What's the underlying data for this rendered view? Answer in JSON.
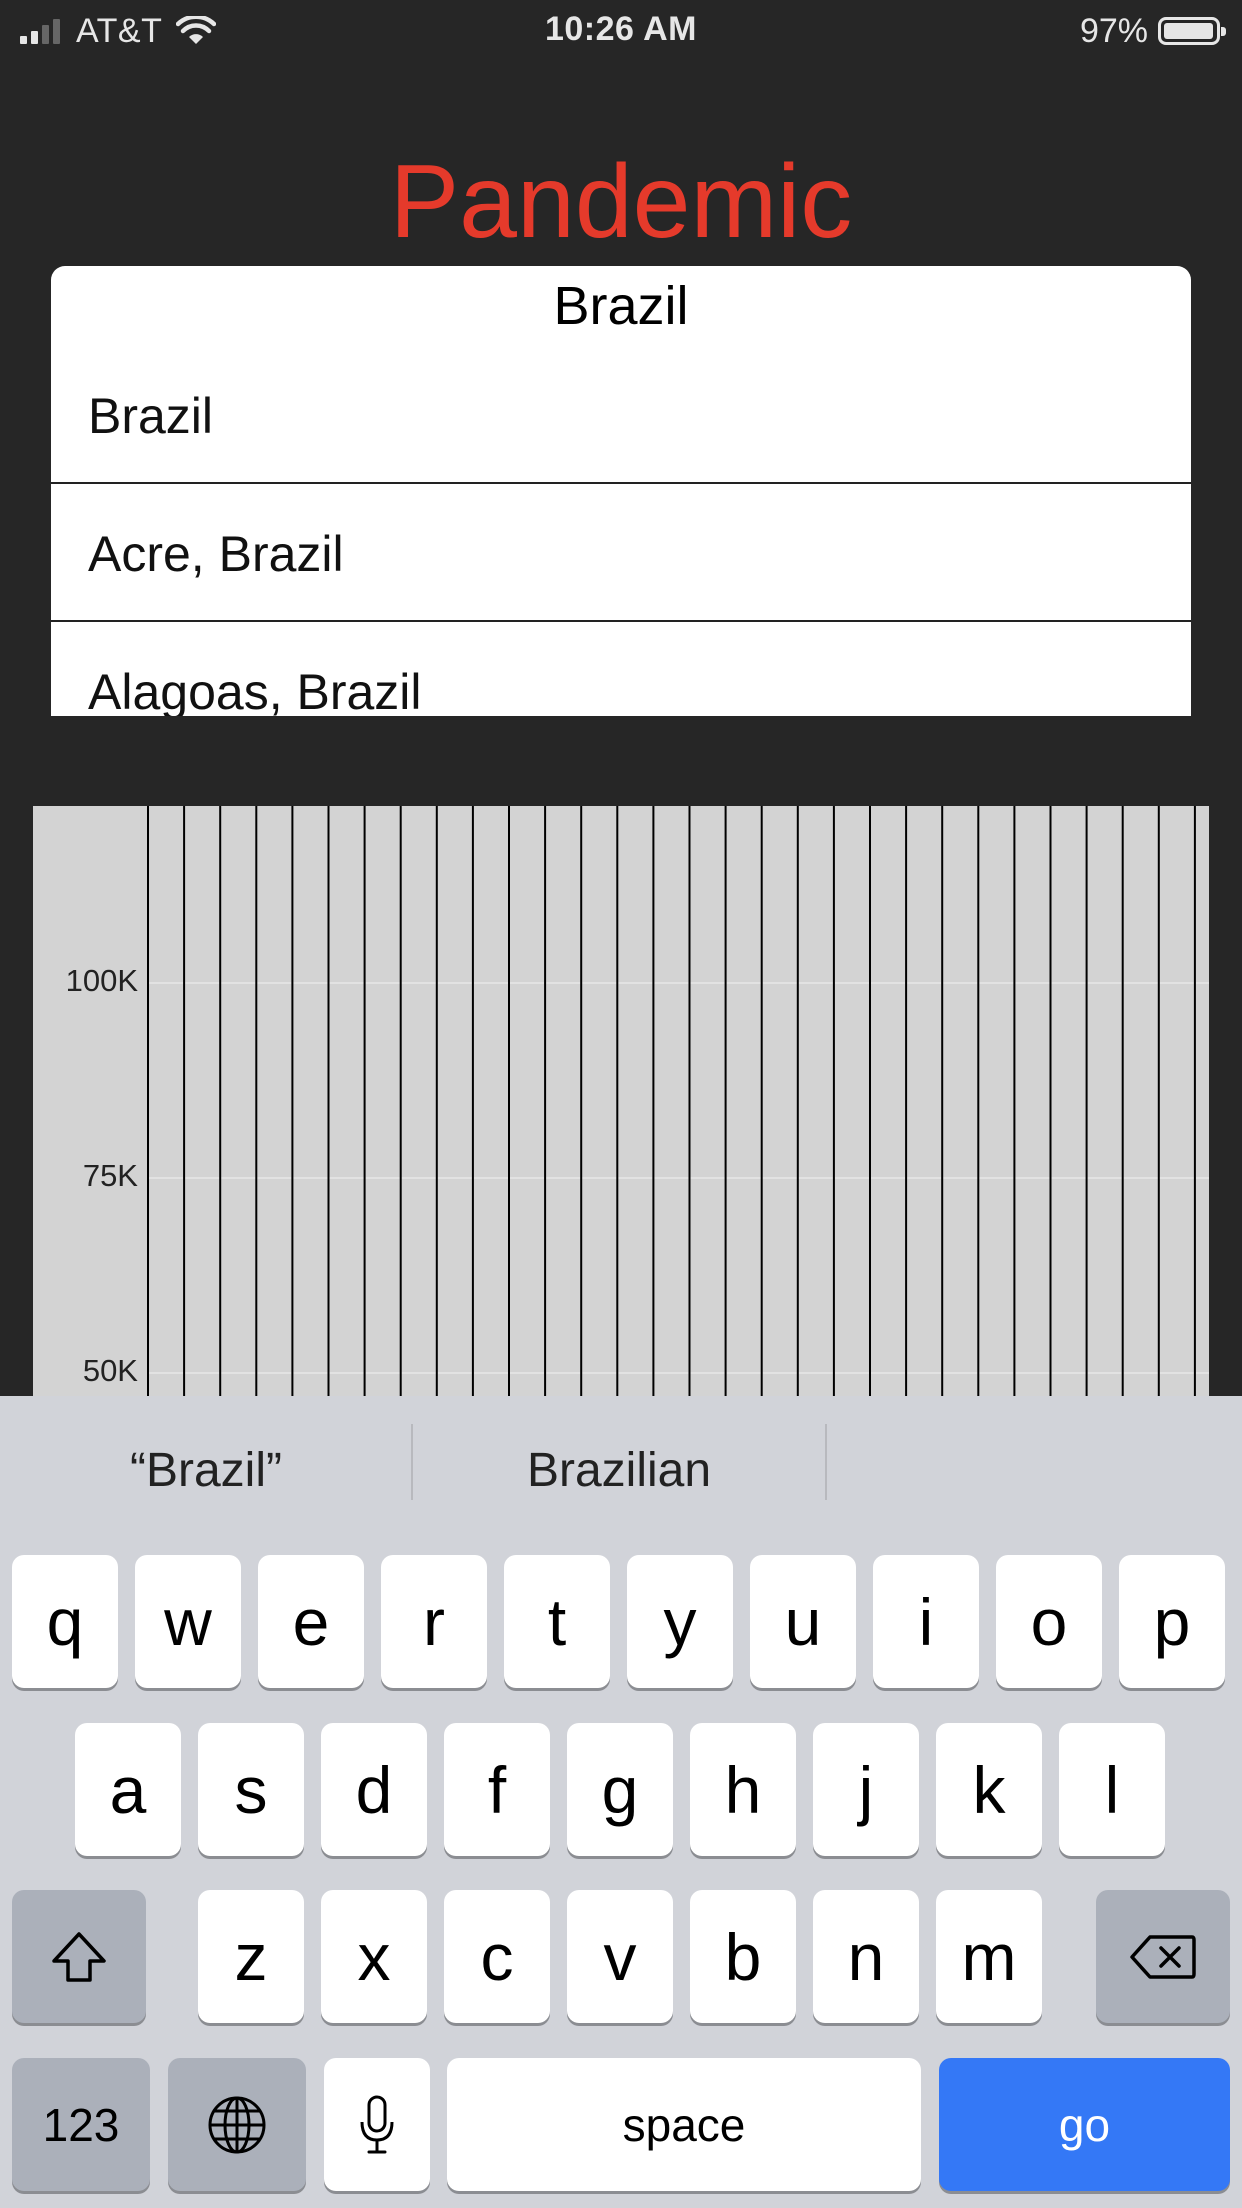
{
  "status_bar": {
    "carrier": "AT&T",
    "time": "10:26 AM",
    "battery_percent": "97%",
    "battery_level": 0.97
  },
  "app": {
    "title": "Pandemic",
    "title_color": "#e53a2b"
  },
  "search": {
    "value": "Brazil",
    "results": [
      {
        "label": "Brazil"
      },
      {
        "label": "Acre, Brazil"
      },
      {
        "label": "Alagoas, Brazil"
      }
    ]
  },
  "chart_data": {
    "type": "bar",
    "y_ticks": [
      "100K",
      "75K",
      "50K"
    ],
    "grid": true
  },
  "keyboard": {
    "suggestions": [
      "“Brazil”",
      "Brazilian"
    ],
    "rows": [
      [
        "q",
        "w",
        "e",
        "r",
        "t",
        "y",
        "u",
        "i",
        "o",
        "p"
      ],
      [
        "a",
        "s",
        "d",
        "f",
        "g",
        "h",
        "j",
        "k",
        "l"
      ],
      [
        "z",
        "x",
        "c",
        "v",
        "b",
        "n",
        "m"
      ]
    ],
    "numbers_label": "123",
    "space_label": "space",
    "go_label": "go",
    "icons": {
      "shift": "shift-icon",
      "delete": "delete-icon",
      "globe": "globe-icon",
      "mic": "microphone-icon"
    }
  }
}
